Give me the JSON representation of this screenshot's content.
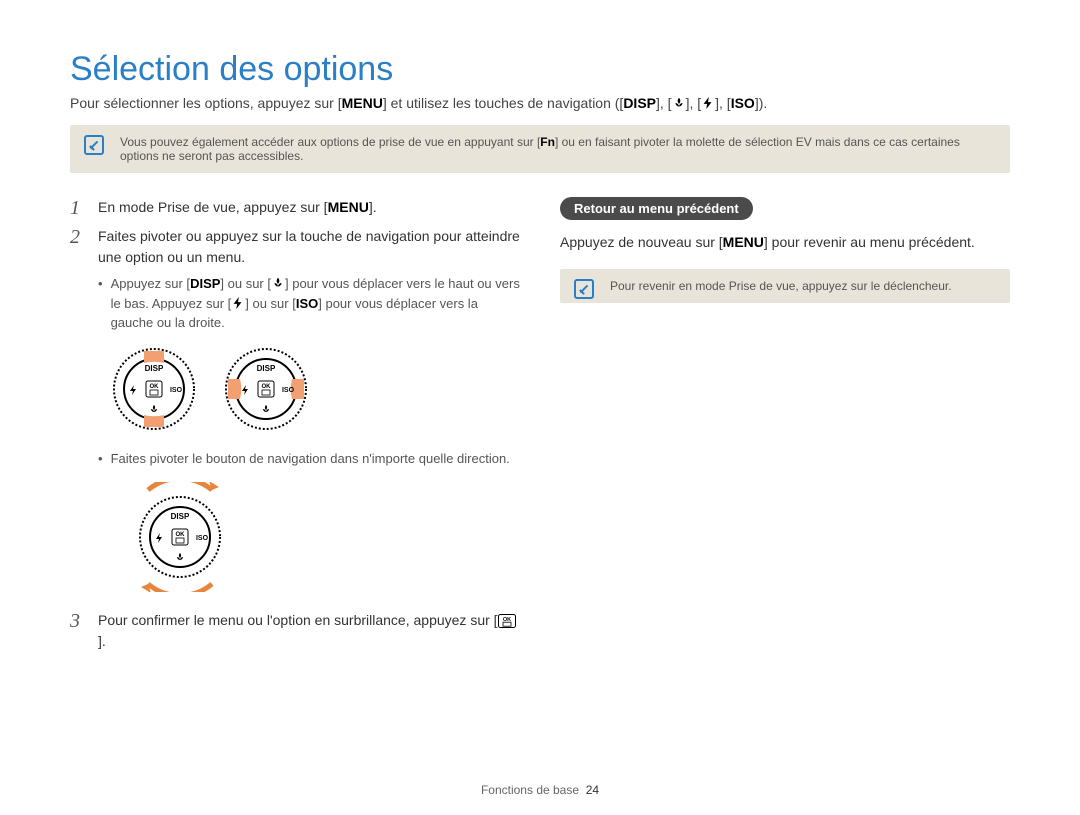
{
  "title": "Sélection des options",
  "intro": {
    "prefix": "Pour sélectionner les options, appuyez sur [",
    "menu": "MENU",
    "mid": "] et utilisez les touches de navigation ([",
    "disp": "DISP",
    "sep1": "], [",
    "sep2": "], [",
    "sep3": "], [",
    "iso": "ISO",
    "suffix": "])."
  },
  "note1": {
    "pre": "Vous pouvez également accéder aux options de prise de vue en appuyant sur [",
    "fn": "Fn",
    "post": "] ou en faisant pivoter la molette de sélection EV mais dans ce cas certaines options ne seront pas accessibles."
  },
  "steps": {
    "s1": {
      "num": "1",
      "pre": "En mode Prise de vue, appuyez sur [",
      "menu": "MENU",
      "post": "]."
    },
    "s2": {
      "num": "2",
      "text": "Faites pivoter ou appuyez sur la touche de navigation pour atteindre une option ou un menu."
    },
    "s2b1": {
      "pre": "Appuyez sur [",
      "disp": "DISP",
      "mid1": "] ou sur [",
      "mid2": "] pour vous déplacer vers le haut ou vers le bas. Appuyez sur [",
      "mid3": "] ou sur [",
      "iso": "ISO",
      "post": "] pour vous déplacer vers la gauche ou la droite."
    },
    "s2b2": "Faites pivoter le bouton de navigation dans n'importe quelle direction.",
    "s3": {
      "num": "3",
      "pre": "Pour confirmer le menu ou l'option en surbrillance, appuyez sur [",
      "ok": "OK",
      "post": "]."
    }
  },
  "right": {
    "pill": "Retour au menu précédent",
    "text_pre": "Appuyez de nouveau sur [",
    "menu": "MENU",
    "text_post": "] pour revenir au menu précédent.",
    "note": "Pour revenir en mode Prise de vue, appuyez sur le déclencheur."
  },
  "footer": {
    "section": "Fonctions de base",
    "page": "24"
  },
  "dial_labels": {
    "top": "DISP",
    "right": "ISO",
    "ok": "OK"
  }
}
